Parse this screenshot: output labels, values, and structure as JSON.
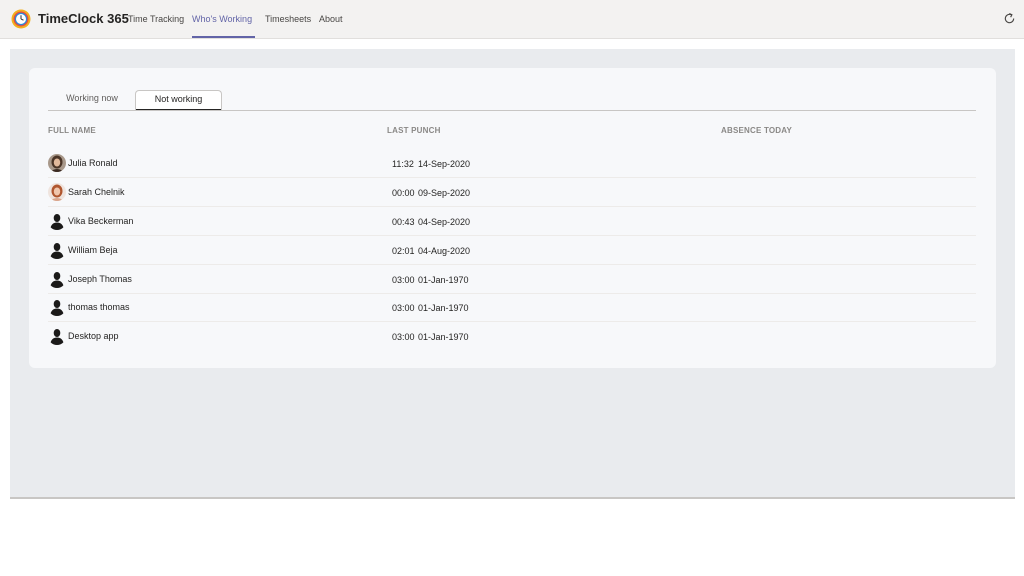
{
  "app": {
    "title": "TimeClock 365",
    "accent_color": "#6264a7",
    "logo_icon": "clock-logo-icon"
  },
  "nav": {
    "tabs": [
      {
        "label": "Time Tracking",
        "active": false
      },
      {
        "label": "Who's Working",
        "active": true
      },
      {
        "label": "Timesheets",
        "active": false
      },
      {
        "label": "About",
        "active": false
      }
    ],
    "refresh_icon": "refresh-icon"
  },
  "subtabs": [
    {
      "label": "Working now",
      "selected": false
    },
    {
      "label": "Not working",
      "selected": true
    }
  ],
  "table": {
    "columns": [
      "FULL NAME",
      "LAST PUNCH",
      "ABSENCE TODAY"
    ],
    "rows": [
      {
        "name": "Julia Ronald",
        "time": "11:32",
        "date": "14-Sep-2020",
        "absence": "",
        "avatar": "photo-julia"
      },
      {
        "name": "Sarah Chelnik",
        "time": "00:00",
        "date": "09-Sep-2020",
        "absence": "",
        "avatar": "photo-sarah"
      },
      {
        "name": "Vika Beckerman",
        "time": "00:43",
        "date": "04-Sep-2020",
        "absence": "",
        "avatar": "silhouette-icon"
      },
      {
        "name": "William Beja",
        "time": "02:01",
        "date": "04-Aug-2020",
        "absence": "",
        "avatar": "silhouette-icon"
      },
      {
        "name": "Joseph Thomas",
        "time": "03:00",
        "date": "01-Jan-1970",
        "absence": "",
        "avatar": "silhouette-icon"
      },
      {
        "name": "thomas thomas",
        "time": "03:00",
        "date": "01-Jan-1970",
        "absence": "",
        "avatar": "silhouette-icon"
      },
      {
        "name": "Desktop app",
        "time": "03:00",
        "date": "01-Jan-1970",
        "absence": "",
        "avatar": "silhouette-icon"
      }
    ]
  }
}
